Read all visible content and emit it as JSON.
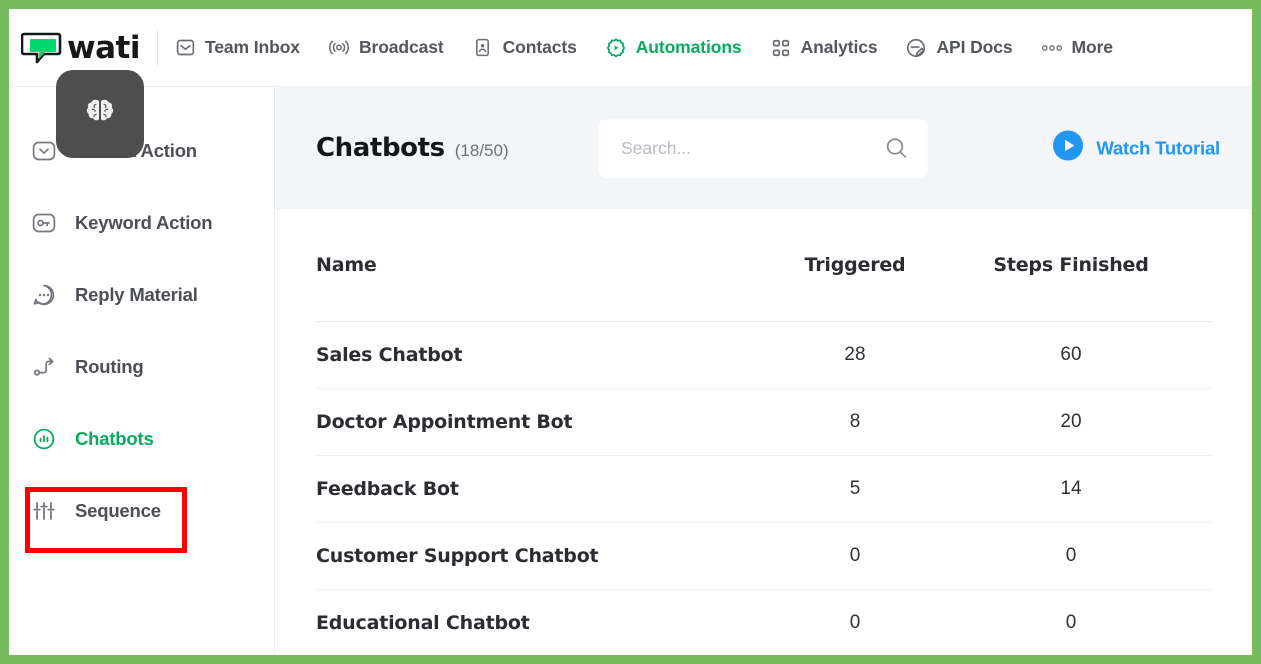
{
  "colors": {
    "frame_green": "#76bb5e",
    "brand_green": "#09ab5f",
    "accent_blue": "#2196f3",
    "highlight_red": "#ff0000",
    "header_bg": "#f4f5f8"
  },
  "topnav": {
    "logo_text": "wati",
    "logo_icon": "wati-chat-logo-icon",
    "items": [
      {
        "label": "Team Inbox",
        "icon": "inbox-icon",
        "active": false
      },
      {
        "label": "Broadcast",
        "icon": "broadcast-icon",
        "active": false
      },
      {
        "label": "Contacts",
        "icon": "contact-card-icon",
        "active": false
      },
      {
        "label": "Automations",
        "icon": "gear-play-icon",
        "active": true
      },
      {
        "label": "Analytics",
        "icon": "grid-squares-icon",
        "active": false
      },
      {
        "label": "API Docs",
        "icon": "api-circle-icon",
        "active": false
      },
      {
        "label": "More",
        "icon": "ellipsis-icon",
        "active": false
      }
    ]
  },
  "sidebar": {
    "items": [
      {
        "label": "Default Action",
        "icon": "chevron-down-box-icon",
        "active": false
      },
      {
        "label": "Keyword Action",
        "icon": "key-box-icon",
        "active": false
      },
      {
        "label": "Reply Material",
        "icon": "chat-dots-icon",
        "active": false
      },
      {
        "label": "Routing",
        "icon": "routing-arrow-icon",
        "active": false
      },
      {
        "label": "Chatbots",
        "icon": "chatbot-chart-icon",
        "active": true
      },
      {
        "label": "Sequence",
        "icon": "sliders-icon",
        "active": false
      }
    ],
    "brain_badge_icon": "brain-icon"
  },
  "header": {
    "title": "Chatbots",
    "count": "(18/50)",
    "search": {
      "placeholder": "Search...",
      "value": "",
      "icon": "search-icon"
    },
    "watch_tutorial": {
      "label": "Watch Tutorial",
      "icon": "play-circle-icon"
    }
  },
  "table": {
    "columns": [
      "Name",
      "Triggered",
      "Steps Finished"
    ],
    "rows": [
      {
        "name": "Sales Chatbot",
        "triggered": "28",
        "steps_finished": "60"
      },
      {
        "name": "Doctor Appointment Bot",
        "triggered": "8",
        "steps_finished": "20"
      },
      {
        "name": "Feedback Bot",
        "triggered": "5",
        "steps_finished": "14"
      },
      {
        "name": "Customer Support Chatbot",
        "triggered": "0",
        "steps_finished": "0"
      },
      {
        "name": "Educational Chatbot",
        "triggered": "0",
        "steps_finished": "0"
      }
    ]
  }
}
